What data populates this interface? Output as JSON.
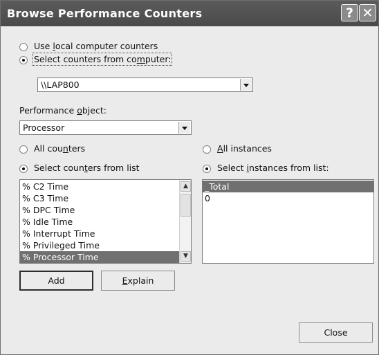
{
  "window": {
    "title": "Browse Performance Counters"
  },
  "titlebar": {
    "help_icon": "question-mark-icon",
    "close_icon": "close-x-icon"
  },
  "source": {
    "local_label_before": "Use ",
    "local_label_key": "l",
    "local_label_after": "ocal computer counters",
    "remote_label_before": "Select counters from co",
    "remote_label_key": "m",
    "remote_label_after": "puter:",
    "selected": "remote",
    "computer_value": "\\\\LAP800"
  },
  "object": {
    "label_before": "Performance ",
    "label_key": "o",
    "label_after": "bject:",
    "value": "Processor"
  },
  "counters": {
    "all_before": "All cou",
    "all_key": "n",
    "all_after": "ters",
    "list_before": "Select coun",
    "list_key": "t",
    "list_after": "ers from list",
    "items": [
      "% C2 Time",
      "% C3 Time",
      "% DPC Time",
      "% Idle Time",
      "% Interrupt Time",
      "% Privileged Time",
      "% Processor Time"
    ],
    "selected": "% Processor Time"
  },
  "instances": {
    "all_key": "A",
    "all_after": "ll instances",
    "list_before": "Select ",
    "list_key": "i",
    "list_after": "nstances from list:",
    "items": [
      "_Total",
      "0"
    ],
    "selected": "_Total"
  },
  "buttons": {
    "add": "Add",
    "explain_key": "E",
    "explain_after": "xplain",
    "close": "Close"
  }
}
